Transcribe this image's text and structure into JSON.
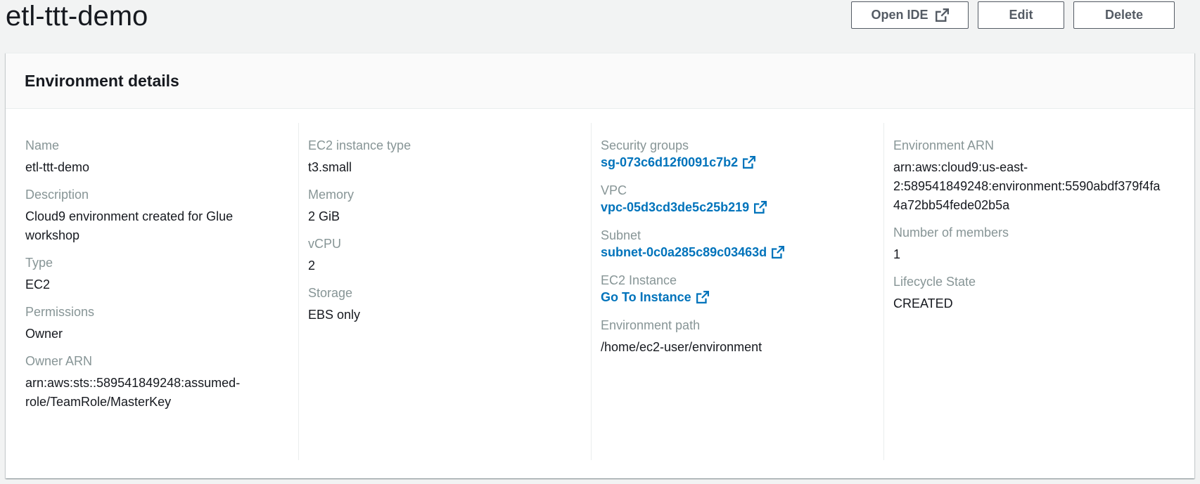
{
  "header": {
    "title": "etl-ttt-demo",
    "buttons": {
      "open_ide": "Open IDE",
      "edit": "Edit",
      "delete": "Delete"
    }
  },
  "panel": {
    "title": "Environment details",
    "col1": {
      "name_label": "Name",
      "name_value": "etl-ttt-demo",
      "description_label": "Description",
      "description_value": "Cloud9 environment created for Glue workshop",
      "type_label": "Type",
      "type_value": "EC2",
      "permissions_label": "Permissions",
      "permissions_value": "Owner",
      "owner_arn_label": "Owner ARN",
      "owner_arn_value": "arn:aws:sts::589541849248:assumed-role/TeamRole/MasterKey"
    },
    "col2": {
      "instance_type_label": "EC2 instance type",
      "instance_type_value": "t3.small",
      "memory_label": "Memory",
      "memory_value": "2 GiB",
      "vcpu_label": "vCPU",
      "vcpu_value": "2",
      "storage_label": "Storage",
      "storage_value": "EBS only"
    },
    "col3": {
      "security_groups_label": "Security groups",
      "security_groups_value": "sg-073c6d12f0091c7b2",
      "vpc_label": "VPC",
      "vpc_value": "vpc-05d3cd3de5c25b219",
      "subnet_label": "Subnet",
      "subnet_value": "subnet-0c0a285c89c03463d",
      "ec2_instance_label": "EC2 Instance",
      "ec2_instance_value": "Go To Instance",
      "env_path_label": "Environment path",
      "env_path_value": "/home/ec2-user/environment"
    },
    "col4": {
      "env_arn_label": "Environment ARN",
      "env_arn_value": "arn:aws:cloud9:us-east-2:589541849248:environment:5590abdf379f4fa4a72bb54fede02b5a",
      "members_label": "Number of members",
      "members_value": "1",
      "lifecycle_label": "Lifecycle State",
      "lifecycle_value": "CREATED"
    }
  },
  "icons": {
    "external_link": "external-link-icon"
  },
  "colors": {
    "link": "#0073bb",
    "label": "#879596",
    "text": "#16191f",
    "background": "#f2f3f3"
  }
}
